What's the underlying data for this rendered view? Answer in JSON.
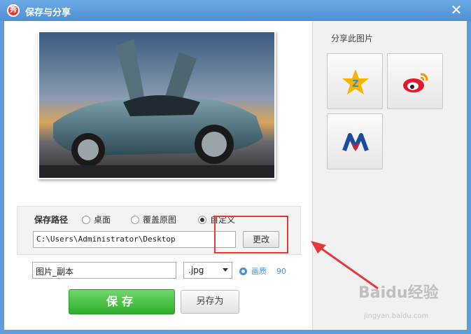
{
  "window": {
    "title": "保存与分享",
    "app_icon_glyph": "秀",
    "close_glyph": "✕"
  },
  "path_panel": {
    "label": "保存路径",
    "options": [
      {
        "label": "桌面",
        "selected": false
      },
      {
        "label": "覆盖原图",
        "selected": false
      },
      {
        "label": "自定义",
        "selected": true
      }
    ],
    "path_value": "C:\\Users\\Administrator\\Desktop",
    "change_label": "更改"
  },
  "file": {
    "name_value": "图片_副本",
    "format_value": ".jpg",
    "quality_label": "画质",
    "quality_value": "90"
  },
  "actions": {
    "save_label": "保存",
    "save_as_label": "另存为"
  },
  "share": {
    "title": "分享此图片",
    "targets": [
      {
        "name": "qzone",
        "icon": "qzone-star-icon"
      },
      {
        "name": "weibo",
        "icon": "weibo-icon"
      },
      {
        "name": "renren",
        "icon": "renren-icon"
      }
    ]
  },
  "watermark": {
    "text": "Baidu经验",
    "sub": "jingyan.baidu.com"
  },
  "colors": {
    "titlebar": "#5d9ddc",
    "save_button": "#3cb838",
    "highlight_box": "#e53935",
    "quality_link": "#4a8fd0"
  }
}
